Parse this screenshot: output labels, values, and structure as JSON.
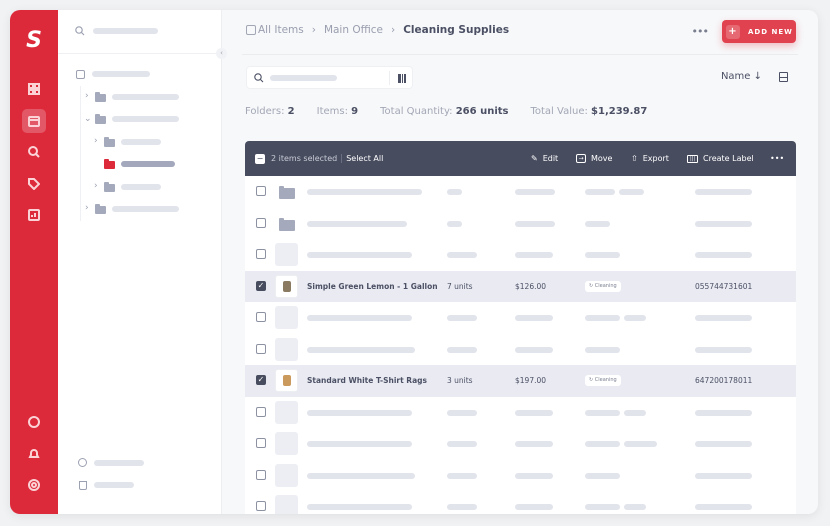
{
  "logo": "S",
  "breadcrumb": {
    "items": [
      "All Items",
      "Main Office"
    ],
    "current": "Cleaning Supplies"
  },
  "add_button": "ADD NEW",
  "more": "•••",
  "sort": {
    "label": "Name ↓"
  },
  "stats": [
    {
      "label": "Folders:",
      "value": "2"
    },
    {
      "label": "Items:",
      "value": "9"
    },
    {
      "label": "Total Quantity:",
      "value": "266 units"
    },
    {
      "label": "Total Value:",
      "value": "$1,239.87"
    }
  ],
  "bulk": {
    "selected": "2 items selected",
    "select_all": "Select All",
    "edit": "Edit",
    "move": "Move",
    "export": "Export",
    "create_label": "Create Label"
  },
  "items": [
    {
      "name": "Simple Green Lemon - 1 Gallon",
      "qty": "7 units",
      "price": "$126.00",
      "tag": "Cleaning",
      "barcode": "055744731601",
      "checked": true
    },
    {
      "name": "Standard White T-Shirt Rags",
      "qty": "3 units",
      "price": "$197.00",
      "tag": "Cleaning",
      "barcode": "647200178011",
      "checked": true
    }
  ],
  "colors": {
    "brand": "#dc2a3b",
    "toolbar": "#474c5f",
    "selected_row": "#e9eaf2"
  }
}
